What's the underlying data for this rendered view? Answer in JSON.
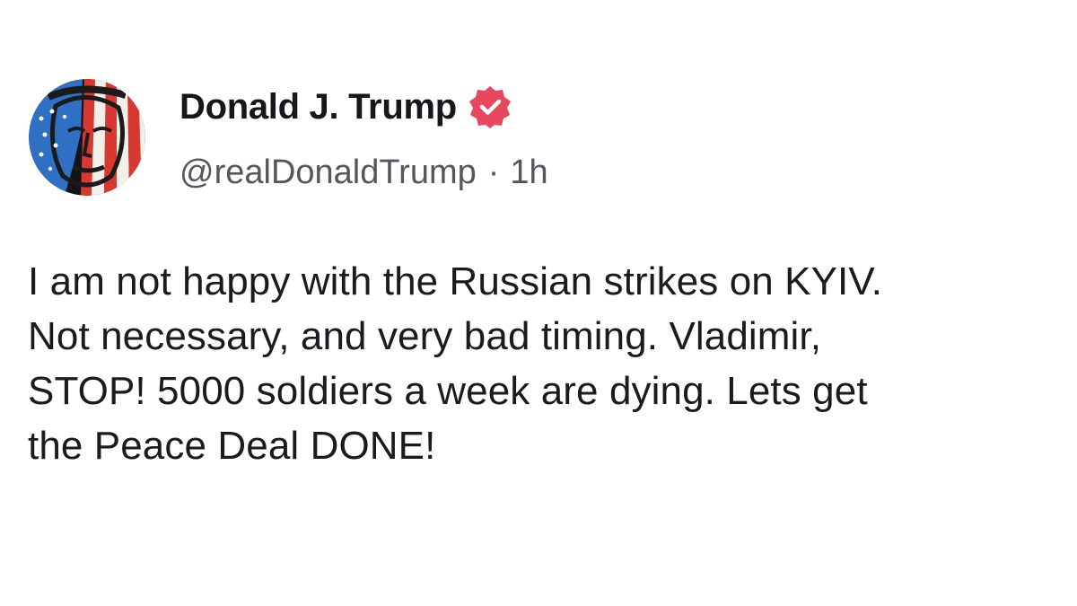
{
  "author": {
    "display_name": "Donald J. Trump",
    "handle": "@realDonaldTrump",
    "separator": "·",
    "time_ago": "1h",
    "verified_badge_color": "#e8475f",
    "avatar_icon": "flag-portrait-avatar"
  },
  "post": {
    "lines": [
      "I am not happy with the Russian strikes on KYIV.",
      "Not necessary, and very bad timing. Vladimir,",
      "STOP! 5000 soldiers a week are dying. Lets get",
      "the Peace Deal DONE!"
    ]
  }
}
